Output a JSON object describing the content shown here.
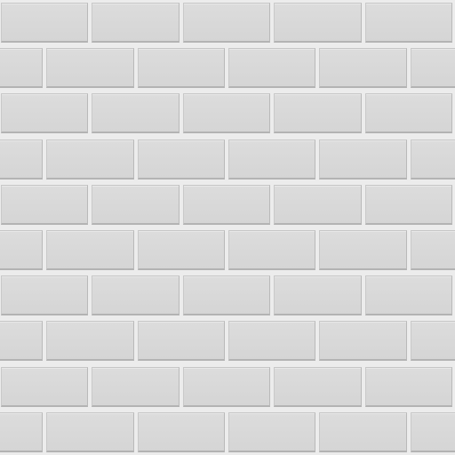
{
  "wall": {
    "rows": 10,
    "columns": 5,
    "tile_color": "#d8d8d8",
    "grout_color": "#ececec",
    "pattern": "running bond"
  }
}
